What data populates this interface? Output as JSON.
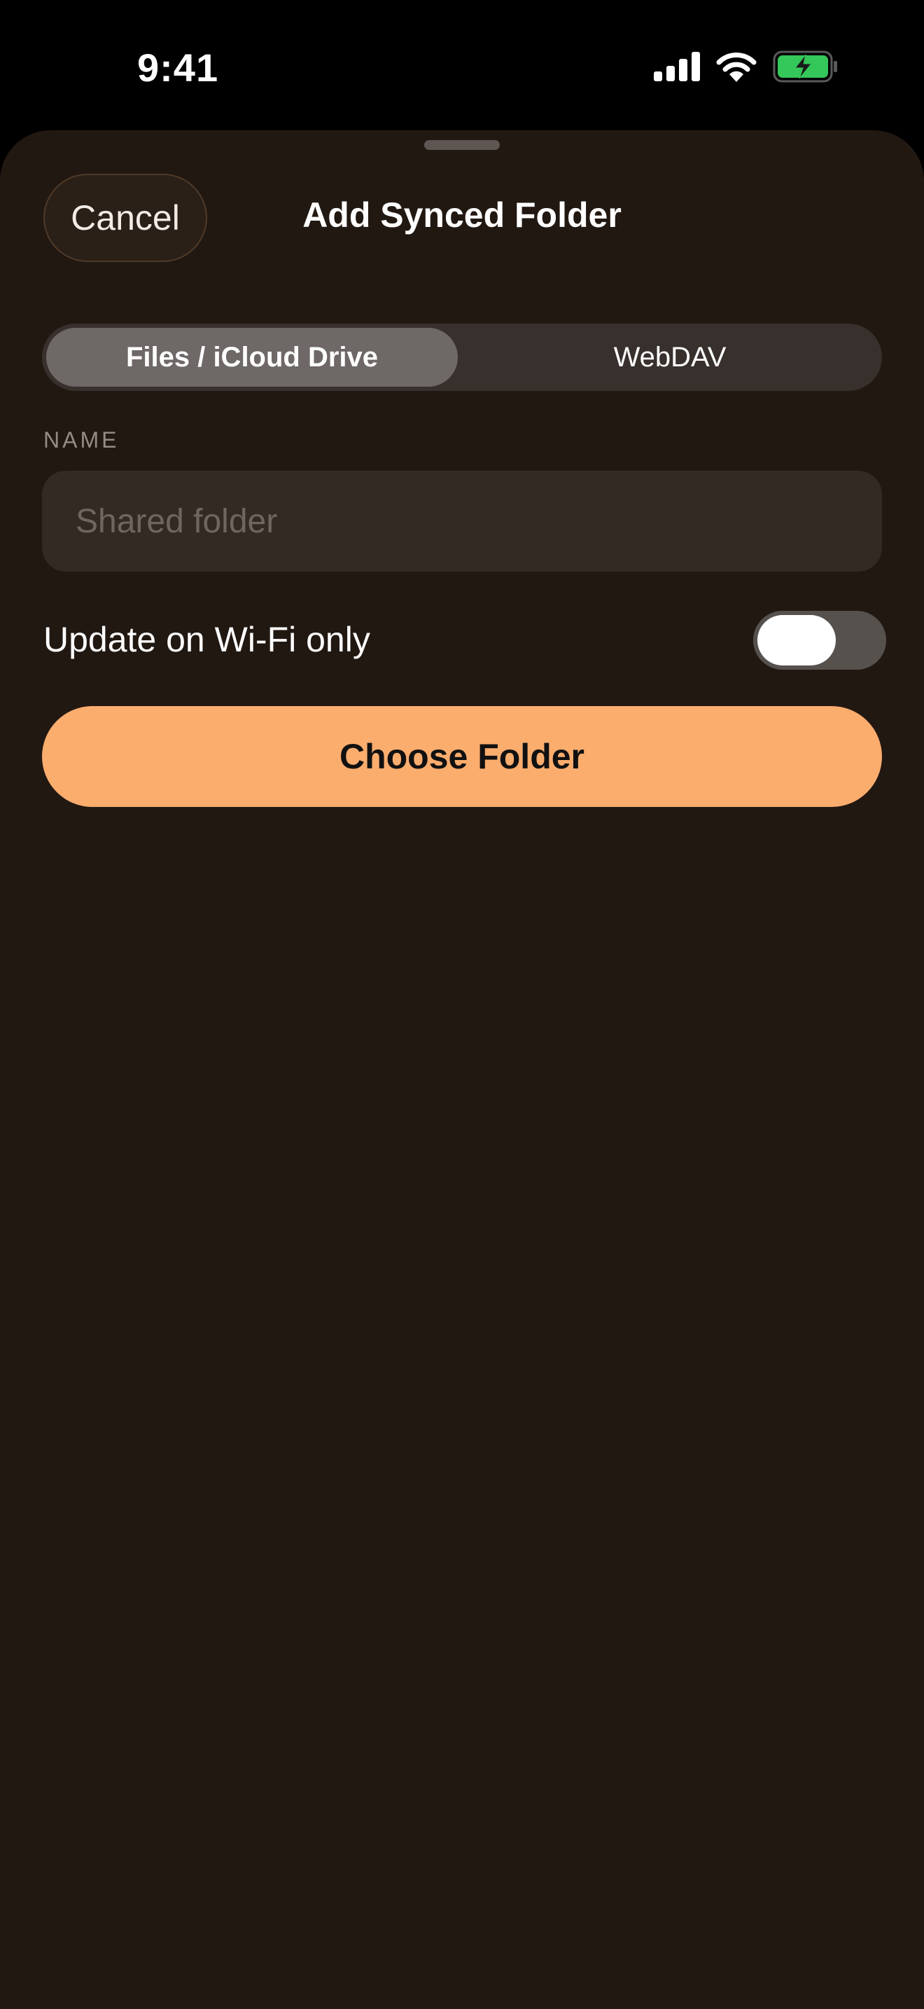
{
  "status_bar": {
    "time": "9:41",
    "icons": [
      "cellular-signal-icon",
      "wifi-icon",
      "battery-charging-icon"
    ],
    "battery_color": "#34c759"
  },
  "sheet": {
    "title": "Add Synced Folder",
    "cancel_label": "Cancel"
  },
  "source_picker": {
    "options": [
      {
        "label": "Files / iCloud Drive",
        "selected": true
      },
      {
        "label": "WebDAV",
        "selected": false
      }
    ]
  },
  "name_section": {
    "label": "NAME",
    "value": "",
    "placeholder": "Shared folder"
  },
  "wifi_toggle": {
    "label": "Update on Wi-Fi only",
    "on": false
  },
  "primary_action": {
    "label": "Choose Folder"
  },
  "colors": {
    "accent": "#fbad6e",
    "background": "#221812"
  }
}
